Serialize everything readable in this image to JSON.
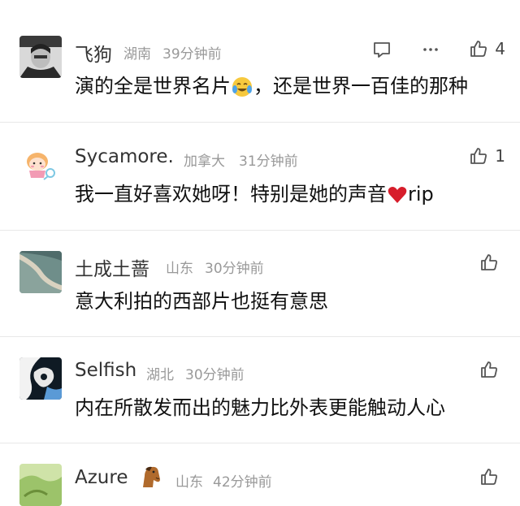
{
  "comments": [
    {
      "user": "飞狗",
      "location": "湖南",
      "time": "39分钟前",
      "text_before": "演的全是世界名片",
      "emoji": "crying-laughing-emoji",
      "text_after": "，还是世界一百佳的那种",
      "likes": "4",
      "avatar": "man-portrait-avatar"
    },
    {
      "user": "Sycamore.",
      "location": "加拿大",
      "time": "31分钟前",
      "text_before": "我一直好喜欢她呀！特别是她的声音",
      "emoji": "red-heart-emoji",
      "text_after": "rip",
      "likes": "1",
      "avatar": "cartoon-girl-avatar"
    },
    {
      "user": "土成土蔷",
      "location": "山东",
      "time": "30分钟前",
      "text_before": "意大利拍的西部片也挺有意思",
      "likes": "",
      "avatar": "river-aerial-avatar"
    },
    {
      "user": "Selfish",
      "location": "湖北",
      "time": "30分钟前",
      "text_before": "内在所散发而出的魅力比外表更能触动人心",
      "likes": "",
      "avatar": "black-white-art-avatar"
    },
    {
      "user": "Azure",
      "location": "山东",
      "time": "42分钟前",
      "text_before": "",
      "likes": "",
      "avatar": "green-landscape-avatar",
      "badge": "horse-emoji"
    }
  ],
  "colors": {
    "text": "#111111",
    "name": "#333333",
    "meta": "#999999",
    "divider": "#e8e8e8"
  }
}
